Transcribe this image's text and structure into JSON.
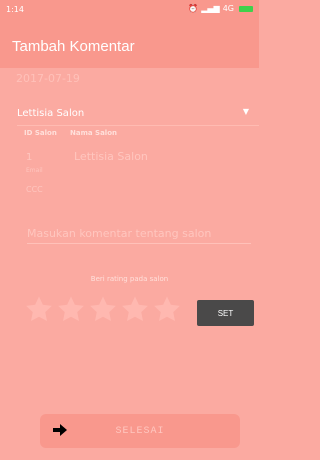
{
  "status_bar": {
    "time": "1:14",
    "network": "4G"
  },
  "app_bar": {
    "title": "Tambah Komentar"
  },
  "date": "2017-07-19",
  "salon_dropdown": {
    "selected": "Lettisia Salon"
  },
  "salon_info": {
    "id_header": "ID Salon",
    "name_header": "Nama Salon",
    "id_value": "1",
    "name_value": "Lettisia Salon",
    "email_label": "Email",
    "email_value": "CCC"
  },
  "comment": {
    "placeholder": "Masukan komentar tentang salon",
    "value": ""
  },
  "rating": {
    "label": "Beri rating pada salon",
    "value": 0,
    "max": 5
  },
  "set_button": {
    "label": "SET"
  },
  "finish_button": {
    "label": "SELESAI",
    "icon": "arrow-right-icon"
  },
  "colors": {
    "app_bar": "#f9988d",
    "background": "#fbaaa1",
    "set_button": "#4a4949"
  }
}
